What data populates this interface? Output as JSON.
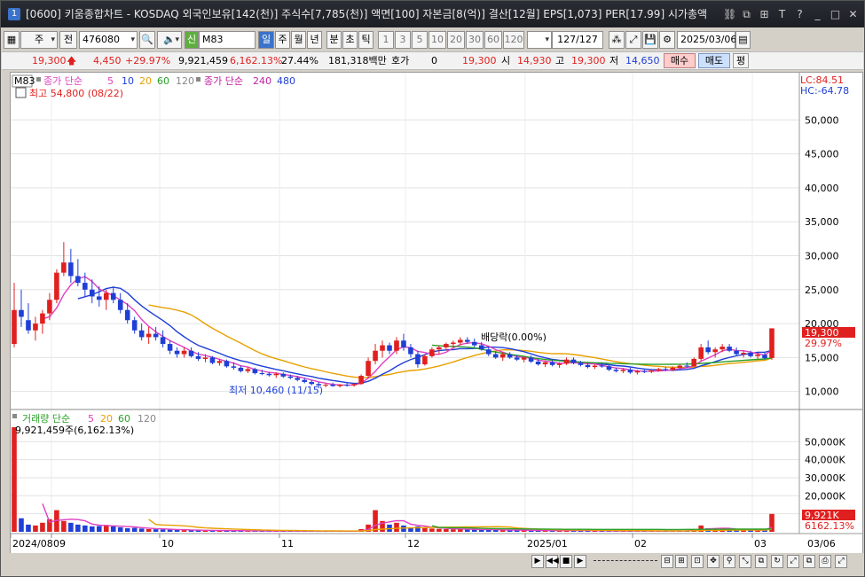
{
  "window": {
    "number": "1",
    "title": "[0600] 키움종합차트 - KOSDAQ 외국인보유[142(천)] 주식수[7,785(천)] 액면[100] 자본금[8(억)] 결산[12월] EPS[1,073] PER[17.99] 시가총액"
  },
  "toolbar": {
    "period_type": "주",
    "prev_label": "전",
    "code": "476080",
    "indicator_prefix": "신",
    "indicator_code": "M83",
    "periods": [
      "일",
      "주",
      "월",
      "년",
      "분",
      "초",
      "틱"
    ],
    "intervals": [
      "1",
      "3",
      "5",
      "10",
      "20",
      "30",
      "60",
      "120"
    ],
    "count": "127/127",
    "date": "2025/03/06"
  },
  "quote": {
    "price": "19,300",
    "change": "4,450",
    "change_pct": "+29.97%",
    "volume": "9,921,459",
    "volume_ratio": "6,162.13%",
    "turnover": "27.44%",
    "amount": "181,318백만",
    "hoga_label": "호가",
    "hoga_value": "0",
    "bid_price": "19,300",
    "open_label": "시",
    "open": "14,930",
    "high_label": "고",
    "high": "19,300",
    "low_label": "저",
    "low": "14,650",
    "buy_label": "매수",
    "sell_label": "매도",
    "avg_label": "평"
  },
  "price_panel": {
    "legend_tag": "M83",
    "legend_ma_label": "종가 단순",
    "ma_periods": [
      "5",
      "10",
      "20",
      "60",
      "120"
    ],
    "legend_long_label": "종가 단순",
    "long_periods": [
      "240",
      "480"
    ],
    "high_note": "최고 54,800 (08/22)",
    "low_note": "최저 10,460 (11/15)",
    "event_note": "배당락(0.00%)",
    "lc": "LC:84.51",
    "hc": "HC:-64.78",
    "current_price_tag": "19,300",
    "current_pct_tag": "29.97%",
    "y_ticks": [
      "50,000",
      "45,000",
      "40,000",
      "35,000",
      "30,000",
      "25,000",
      "20,000",
      "15,000",
      "10,000"
    ]
  },
  "volume_panel": {
    "legend_label": "거래량 단순",
    "ma_periods": [
      "5",
      "20",
      "60",
      "120"
    ],
    "volume_note": "9,921,459주(6,162.13%)",
    "y_ticks": [
      "50,000K",
      "40,000K",
      "30,000K",
      "20,000K",
      "10,000K"
    ],
    "current_tag": "9,921K",
    "current_pct_tag": "6162.13%"
  },
  "x_axis": {
    "labels": [
      "2024/08",
      "09",
      "10",
      "11",
      "12",
      "2025/01",
      "02",
      "03"
    ],
    "right_label": "03/06"
  },
  "colors": {
    "up": "#e0201f",
    "down": "#1f3fd6",
    "ma5": "#e040c0",
    "ma10": "#1f3fd6",
    "ma20": "#e8a000",
    "ma60": "#2aa02a",
    "ma120": "#888888"
  },
  "chart_data": {
    "type": "candlestick",
    "price_range": [
      8000,
      55000
    ],
    "candles": [
      [
        17000,
        26000,
        16500,
        22000
      ],
      [
        22000,
        25000,
        19500,
        21000
      ],
      [
        20500,
        23000,
        18500,
        19000
      ],
      [
        19000,
        21000,
        17500,
        20000
      ],
      [
        20000,
        22000,
        18500,
        21500
      ],
      [
        21500,
        24500,
        20500,
        23500
      ],
      [
        23500,
        28000,
        23000,
        27500
      ],
      [
        27500,
        32000,
        27000,
        29000
      ],
      [
        29000,
        31000,
        26000,
        27000
      ],
      [
        27000,
        29500,
        25500,
        26000
      ],
      [
        26000,
        27500,
        24000,
        25000
      ],
      [
        25000,
        26500,
        23000,
        24000
      ],
      [
        24000,
        25500,
        22500,
        23500
      ],
      [
        23500,
        25000,
        22000,
        24500
      ],
      [
        24500,
        25500,
        23000,
        23500
      ],
      [
        23500,
        24500,
        21500,
        22000
      ],
      [
        22000,
        23000,
        20000,
        20500
      ],
      [
        20500,
        21000,
        18500,
        19000
      ],
      [
        19000,
        20000,
        17500,
        18000
      ],
      [
        18000,
        19500,
        17000,
        18500
      ],
      [
        18500,
        19500,
        17500,
        18000
      ],
      [
        18000,
        19000,
        16500,
        17000
      ],
      [
        17000,
        17500,
        15500,
        16000
      ],
      [
        16000,
        16500,
        15000,
        15500
      ],
      [
        15500,
        16500,
        15000,
        16000
      ],
      [
        16000,
        16500,
        15000,
        15200
      ],
      [
        15200,
        15800,
        14500,
        14800
      ],
      [
        14800,
        15500,
        14300,
        15000
      ],
      [
        15000,
        15200,
        14000,
        14200
      ],
      [
        14200,
        14800,
        13800,
        14500
      ],
      [
        14500,
        14700,
        13500,
        13700
      ],
      [
        13700,
        14300,
        13200,
        13500
      ],
      [
        13500,
        13800,
        12800,
        13000
      ],
      [
        13000,
        13600,
        12700,
        13300
      ],
      [
        13300,
        13500,
        12500,
        12700
      ],
      [
        12700,
        13200,
        12400,
        12600
      ],
      [
        12600,
        12900,
        12200,
        12400
      ],
      [
        12400,
        12800,
        12000,
        12600
      ],
      [
        12600,
        12800,
        12000,
        12200
      ],
      [
        12200,
        12500,
        11800,
        12000
      ],
      [
        12000,
        12300,
        11500,
        11700
      ],
      [
        11700,
        12000,
        11200,
        11400
      ],
      [
        11400,
        11700,
        10900,
        11100
      ],
      [
        11100,
        11400,
        10460,
        10900
      ],
      [
        10900,
        11200,
        10600,
        11000
      ],
      [
        11000,
        11300,
        10700,
        10800
      ],
      [
        10800,
        11100,
        10600,
        11000
      ],
      [
        11000,
        11300,
        10700,
        10900
      ],
      [
        10900,
        11200,
        10700,
        11100
      ],
      [
        11100,
        12500,
        11000,
        12300
      ],
      [
        12300,
        15000,
        12000,
        14500
      ],
      [
        14500,
        17000,
        14000,
        16000
      ],
      [
        16000,
        17500,
        15000,
        16800
      ],
      [
        16800,
        17200,
        15500,
        16000
      ],
      [
        16000,
        18000,
        15500,
        17500
      ],
      [
        17500,
        18500,
        16000,
        16500
      ],
      [
        16500,
        17000,
        15000,
        15500
      ],
      [
        15500,
        16000,
        13500,
        14000
      ],
      [
        14000,
        15500,
        13800,
        15200
      ],
      [
        15200,
        16500,
        15000,
        16200
      ],
      [
        16200,
        16800,
        15500,
        16500
      ],
      [
        16500,
        17200,
        16000,
        17000
      ],
      [
        17000,
        17500,
        16500,
        17200
      ],
      [
        17200,
        18000,
        16800,
        17600
      ],
      [
        17600,
        18000,
        17000,
        17300
      ],
      [
        17300,
        17800,
        16500,
        16800
      ],
      [
        16800,
        17300,
        16000,
        16200
      ],
      [
        16200,
        16500,
        15200,
        15500
      ],
      [
        15500,
        15900,
        14800,
        15000
      ],
      [
        15000,
        15800,
        14500,
        15500
      ],
      [
        15500,
        15800,
        14800,
        15000
      ],
      [
        15000,
        15400,
        14500,
        14700
      ],
      [
        14700,
        15200,
        14300,
        15000
      ],
      [
        15000,
        15300,
        14200,
        14400
      ],
      [
        14400,
        14800,
        13800,
        14000
      ],
      [
        14000,
        14500,
        13600,
        14300
      ],
      [
        14300,
        14600,
        13700,
        13900
      ],
      [
        13900,
        14300,
        13500,
        14100
      ],
      [
        14100,
        15000,
        13900,
        14700
      ],
      [
        14700,
        15000,
        14000,
        14200
      ],
      [
        14200,
        14500,
        13700,
        13900
      ],
      [
        13900,
        14200,
        13400,
        13600
      ],
      [
        13600,
        14000,
        13300,
        13800
      ],
      [
        13800,
        14200,
        13500,
        13700
      ],
      [
        13700,
        14000,
        13000,
        13200
      ],
      [
        13200,
        13500,
        12800,
        13000
      ],
      [
        13000,
        13400,
        12700,
        13200
      ],
      [
        13200,
        13500,
        12600,
        12800
      ],
      [
        12800,
        13200,
        12500,
        13000
      ],
      [
        13000,
        13300,
        12700,
        12900
      ],
      [
        12900,
        13300,
        12700,
        13100
      ],
      [
        13100,
        13500,
        12900,
        13300
      ],
      [
        13300,
        13600,
        13000,
        13200
      ],
      [
        13200,
        13700,
        13000,
        13500
      ],
      [
        13500,
        14000,
        13300,
        13800
      ],
      [
        13800,
        14300,
        13500,
        13700
      ],
      [
        13700,
        15000,
        13600,
        14800
      ],
      [
        14800,
        17000,
        14500,
        16500
      ],
      [
        16500,
        17500,
        15500,
        15800
      ],
      [
        15800,
        16500,
        15000,
        16200
      ],
      [
        16200,
        17000,
        15800,
        16600
      ],
      [
        16600,
        17000,
        15800,
        16000
      ],
      [
        16000,
        16500,
        15200,
        15500
      ],
      [
        15500,
        16000,
        15000,
        15700
      ],
      [
        15700,
        16000,
        15000,
        15200
      ],
      [
        15200,
        15700,
        14800,
        15400
      ],
      [
        15400,
        15800,
        14700,
        14900
      ],
      [
        14930,
        19300,
        14650,
        19300
      ]
    ],
    "volume_range": [
      0,
      58000
    ],
    "volumes": [
      58000,
      7500,
      4000,
      3500,
      5000,
      7000,
      12000,
      6000,
      5000,
      4000,
      3500,
      3000,
      3200,
      3800,
      3000,
      2500,
      2000,
      2200,
      1800,
      1500,
      1400,
      1300,
      1200,
      1000,
      900,
      800,
      800,
      700,
      700,
      650,
      600,
      600,
      550,
      500,
      500,
      450,
      450,
      420,
      400,
      380,
      380,
      360,
      500,
      400,
      350,
      320,
      300,
      320,
      350,
      1500,
      4000,
      12000,
      6000,
      4000,
      5000,
      3500,
      2500,
      3000,
      2000,
      1800,
      1600,
      1500,
      1400,
      1500,
      1300,
      1200,
      1100,
      1200,
      1000,
      900,
      900,
      800,
      850,
      800,
      700,
      650,
      700,
      650,
      900,
      700,
      600,
      550,
      500,
      520,
      480,
      450,
      450,
      430,
      420,
      400,
      400,
      420,
      450,
      500,
      550,
      600,
      1500,
      3500,
      2000,
      1500,
      1400,
      1200,
      1000,
      900,
      850,
      800,
      700,
      9921
    ]
  }
}
